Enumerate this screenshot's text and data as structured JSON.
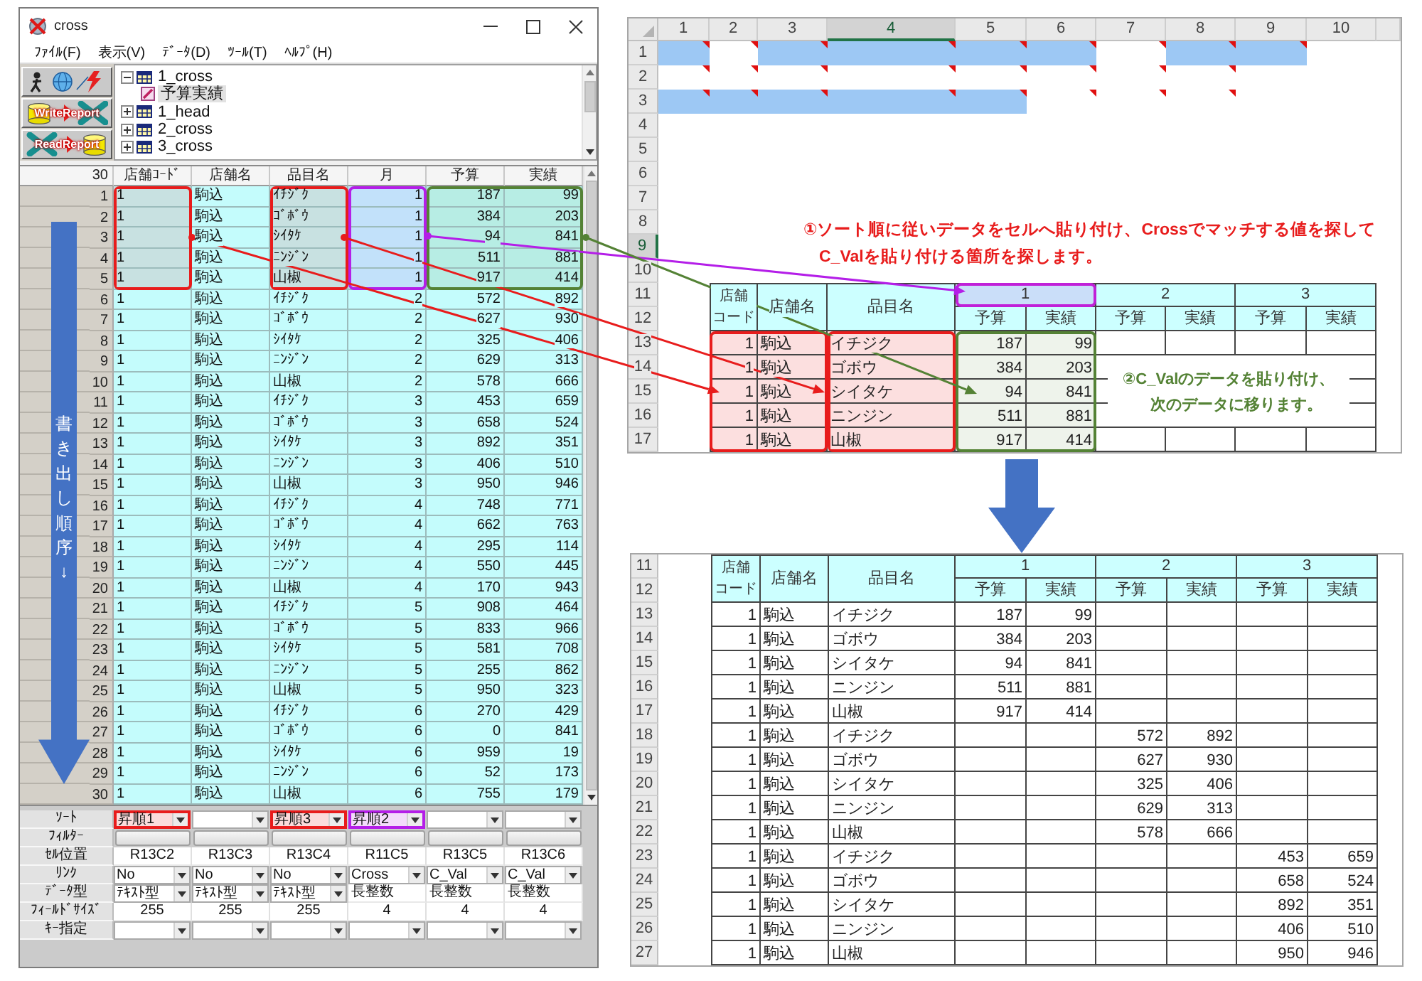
{
  "app_window": {
    "title": "cross",
    "menu": [
      "ﾌｧｲﾙ(F)",
      "表示(V)",
      "ﾃﾞｰﾀ(D)",
      "ﾂｰﾙ(T)",
      "ﾍﾙﾌﾟ(H)"
    ],
    "toolbar": [
      {
        "kind": "connect"
      },
      {
        "kind": "write",
        "label": "WriteReport"
      },
      {
        "kind": "read",
        "label": "ReadReport"
      }
    ],
    "tree": [
      {
        "label": "1_cross",
        "expanded": true,
        "selected": false,
        "children": [
          {
            "label": "予算実績",
            "selected": true
          }
        ]
      },
      {
        "label": "1_head",
        "expanded": false,
        "selected": false
      },
      {
        "label": "2_cross",
        "expanded": false,
        "selected": false
      },
      {
        "label": "3_cross",
        "expanded": false,
        "selected": false
      }
    ],
    "grid": {
      "corner": "30",
      "order_label": "書き出し順序↓",
      "columns": [
        {
          "label": "店舗ｺｰﾄﾞ",
          "kind": "text",
          "color": "#e81c1c"
        },
        {
          "label": "店舗名",
          "kind": "text"
        },
        {
          "label": "品目名",
          "kind": "text",
          "color": "#e81c1c"
        },
        {
          "label": "月",
          "kind": "number",
          "color": "#b41ee8"
        },
        {
          "label": "予算",
          "kind": "number",
          "color": "#548235"
        },
        {
          "label": "実績",
          "kind": "number",
          "color": "#548235"
        }
      ],
      "rows": [
        {
          "number": "1",
          "highlighted": true,
          "cells": [
            "1",
            "駒込",
            "ｲﾁｼﾞｸ",
            "1",
            "187",
            "99"
          ]
        },
        {
          "number": "2",
          "highlighted": true,
          "cells": [
            "1",
            "駒込",
            "ｺﾞﾎﾞｳ",
            "1",
            "384",
            "203"
          ]
        },
        {
          "number": "3",
          "highlighted": true,
          "cells": [
            "1",
            "駒込",
            "ｼｲﾀｹ",
            "1",
            "94",
            "841"
          ]
        },
        {
          "number": "4",
          "highlighted": true,
          "cells": [
            "1",
            "駒込",
            "ﾆﾝｼﾞﾝ",
            "1",
            "511",
            "881"
          ]
        },
        {
          "number": "5",
          "highlighted": true,
          "cells": [
            "1",
            "駒込",
            "山椒",
            "1",
            "917",
            "414"
          ]
        },
        {
          "number": "6",
          "highlighted": false,
          "cells": [
            "1",
            "駒込",
            "ｲﾁｼﾞｸ",
            "2",
            "572",
            "892"
          ]
        },
        {
          "number": "7",
          "highlighted": false,
          "cells": [
            "1",
            "駒込",
            "ｺﾞﾎﾞｳ",
            "2",
            "627",
            "930"
          ]
        },
        {
          "number": "8",
          "highlighted": false,
          "cells": [
            "1",
            "駒込",
            "ｼｲﾀｹ",
            "2",
            "325",
            "406"
          ]
        },
        {
          "number": "9",
          "highlighted": false,
          "cells": [
            "1",
            "駒込",
            "ﾆﾝｼﾞﾝ",
            "2",
            "629",
            "313"
          ]
        },
        {
          "number": "10",
          "highlighted": false,
          "cells": [
            "1",
            "駒込",
            "山椒",
            "2",
            "578",
            "666"
          ]
        },
        {
          "number": "11",
          "highlighted": false,
          "cells": [
            "1",
            "駒込",
            "ｲﾁｼﾞｸ",
            "3",
            "453",
            "659"
          ]
        },
        {
          "number": "12",
          "highlighted": false,
          "cells": [
            "1",
            "駒込",
            "ｺﾞﾎﾞｳ",
            "3",
            "658",
            "524"
          ]
        },
        {
          "number": "13",
          "highlighted": false,
          "cells": [
            "1",
            "駒込",
            "ｼｲﾀｹ",
            "3",
            "892",
            "351"
          ]
        },
        {
          "number": "14",
          "highlighted": false,
          "cells": [
            "1",
            "駒込",
            "ﾆﾝｼﾞﾝ",
            "3",
            "406",
            "510"
          ]
        },
        {
          "number": "15",
          "highlighted": false,
          "cells": [
            "1",
            "駒込",
            "山椒",
            "3",
            "950",
            "946"
          ]
        },
        {
          "number": "16",
          "highlighted": false,
          "cells": [
            "1",
            "駒込",
            "ｲﾁｼﾞｸ",
            "4",
            "748",
            "771"
          ]
        },
        {
          "number": "17",
          "highlighted": false,
          "cells": [
            "1",
            "駒込",
            "ｺﾞﾎﾞｳ",
            "4",
            "662",
            "763"
          ]
        },
        {
          "number": "18",
          "highlighted": false,
          "cells": [
            "1",
            "駒込",
            "ｼｲﾀｹ",
            "4",
            "295",
            "114"
          ]
        },
        {
          "number": "19",
          "highlighted": false,
          "cells": [
            "1",
            "駒込",
            "ﾆﾝｼﾞﾝ",
            "4",
            "550",
            "445"
          ]
        },
        {
          "number": "20",
          "highlighted": false,
          "cells": [
            "1",
            "駒込",
            "山椒",
            "4",
            "170",
            "943"
          ]
        },
        {
          "number": "21",
          "highlighted": false,
          "cells": [
            "1",
            "駒込",
            "ｲﾁｼﾞｸ",
            "5",
            "908",
            "464"
          ]
        },
        {
          "number": "22",
          "highlighted": false,
          "cells": [
            "1",
            "駒込",
            "ｺﾞﾎﾞｳ",
            "5",
            "833",
            "966"
          ]
        },
        {
          "number": "23",
          "highlighted": false,
          "cells": [
            "1",
            "駒込",
            "ｼｲﾀｹ",
            "5",
            "581",
            "708"
          ]
        },
        {
          "number": "24",
          "highlighted": false,
          "cells": [
            "1",
            "駒込",
            "ﾆﾝｼﾞﾝ",
            "5",
            "255",
            "862"
          ]
        },
        {
          "number": "25",
          "highlighted": false,
          "cells": [
            "1",
            "駒込",
            "山椒",
            "5",
            "950",
            "323"
          ]
        },
        {
          "number": "26",
          "highlighted": false,
          "cells": [
            "1",
            "駒込",
            "ｲﾁｼﾞｸ",
            "6",
            "270",
            "429"
          ]
        },
        {
          "number": "27",
          "highlighted": false,
          "cells": [
            "1",
            "駒込",
            "ｺﾞﾎﾞｳ",
            "6",
            "0",
            "841"
          ]
        },
        {
          "number": "28",
          "highlighted": false,
          "cells": [
            "1",
            "駒込",
            "ｼｲﾀｹ",
            "6",
            "959",
            "19"
          ]
        },
        {
          "number": "29",
          "highlighted": false,
          "cells": [
            "1",
            "駒込",
            "ﾆﾝｼﾞﾝ",
            "6",
            "52",
            "173"
          ]
        },
        {
          "number": "30",
          "highlighted": false,
          "cells": [
            "1",
            "駒込",
            "山椒",
            "6",
            "755",
            "179"
          ]
        }
      ]
    },
    "settings": [
      {
        "label": "ｿｰﾄ",
        "cells": [
          {
            "kind": "dropdown",
            "value": "昇順1",
            "color": "#e81c1c"
          },
          {
            "kind": "dropdown"
          },
          {
            "kind": "dropdown",
            "value": "昇順3",
            "color": "#e81c1c"
          },
          {
            "kind": "dropdown",
            "value": "昇順2",
            "color": "#b41ee8"
          },
          {
            "kind": "dropdown"
          },
          {
            "kind": "dropdown"
          }
        ]
      },
      {
        "label": "ﾌｨﾙﾀｰ",
        "cells": [
          {
            "kind": "button"
          },
          {
            "kind": "button"
          },
          {
            "kind": "button"
          },
          {
            "kind": "button"
          },
          {
            "kind": "button"
          },
          {
            "kind": "button"
          }
        ]
      },
      {
        "label": "ｾﾙ位置",
        "cells": [
          {
            "kind": "readout",
            "value": "R13C2"
          },
          {
            "kind": "readout",
            "value": "R13C3"
          },
          {
            "kind": "readout",
            "value": "R13C4"
          },
          {
            "kind": "readout",
            "value": "R11C5"
          },
          {
            "kind": "readout",
            "value": "R13C5"
          },
          {
            "kind": "readout",
            "value": "R13C6"
          }
        ]
      },
      {
        "label": "ﾘﾝｸ",
        "cells": [
          {
            "kind": "dropdown",
            "value": "No"
          },
          {
            "kind": "dropdown",
            "value": "No"
          },
          {
            "kind": "dropdown",
            "value": "No"
          },
          {
            "kind": "dropdown",
            "value": "Cross"
          },
          {
            "kind": "dropdown",
            "value": "C_Val"
          },
          {
            "kind": "dropdown",
            "value": "C_Val"
          }
        ]
      },
      {
        "label": "ﾃﾞｰﾀ型",
        "cells": [
          {
            "kind": "dropdown",
            "value": "ﾃｷｽﾄ型"
          },
          {
            "kind": "dropdown",
            "value": "ﾃｷｽﾄ型"
          },
          {
            "kind": "dropdown",
            "value": "ﾃｷｽﾄ型"
          },
          {
            "kind": "text",
            "value": "長整数"
          },
          {
            "kind": "text",
            "value": "長整数"
          },
          {
            "kind": "text",
            "value": "長整数"
          }
        ]
      },
      {
        "label": "ﾌｨｰﾙﾄﾞｻｲｽﾞ",
        "cells": [
          {
            "kind": "readout",
            "value": "255"
          },
          {
            "kind": "readout",
            "value": "255"
          },
          {
            "kind": "readout",
            "value": "255"
          },
          {
            "kind": "readout",
            "value": "4"
          },
          {
            "kind": "readout",
            "value": "4"
          },
          {
            "kind": "readout",
            "value": "4"
          }
        ]
      },
      {
        "label": "ｷｰ指定",
        "cells": [
          {
            "kind": "dropdown"
          },
          {
            "kind": "dropdown"
          },
          {
            "kind": "dropdown"
          },
          {
            "kind": "dropdown"
          },
          {
            "kind": "dropdown"
          },
          {
            "kind": "dropdown"
          }
        ]
      }
    ]
  },
  "sheet_top": {
    "columns": [
      {
        "label": "1",
        "selected": false
      },
      {
        "label": "2",
        "selected": false
      },
      {
        "label": "3",
        "selected": false
      },
      {
        "label": "4",
        "selected": true
      },
      {
        "label": "5",
        "selected": false
      },
      {
        "label": "6",
        "selected": false
      },
      {
        "label": "7",
        "selected": false
      },
      {
        "label": "8",
        "selected": false
      },
      {
        "label": "9",
        "selected": false
      },
      {
        "label": "10",
        "selected": false
      }
    ],
    "rows": [
      {
        "label": "1",
        "selected": false
      },
      {
        "label": "2",
        "selected": false
      },
      {
        "label": "3",
        "selected": false
      },
      {
        "label": "4",
        "selected": false
      },
      {
        "label": "5",
        "selected": false
      },
      {
        "label": "6",
        "selected": false
      },
      {
        "label": "7",
        "selected": false
      },
      {
        "label": "8",
        "selected": false
      },
      {
        "label": "9",
        "selected": true
      },
      {
        "label": "10",
        "selected": false
      },
      {
        "label": "11",
        "selected": false
      },
      {
        "label": "12",
        "selected": false
      },
      {
        "label": "13",
        "selected": false
      },
      {
        "label": "14",
        "selected": false
      },
      {
        "label": "15",
        "selected": false
      },
      {
        "label": "16",
        "selected": false
      },
      {
        "label": "17",
        "selected": false
      }
    ],
    "marked_rows": [
      {
        "cells": [
          {
            "filled": true,
            "comment": true
          },
          {
            "filled": false,
            "comment": true
          },
          {
            "filled": true,
            "comment": true
          },
          {
            "filled": true,
            "comment": true
          },
          {
            "filled": true,
            "comment": true
          },
          {
            "filled": true,
            "comment": true
          },
          {
            "filled": false,
            "comment": true
          },
          {
            "filled": true,
            "comment": true
          },
          {
            "filled": true,
            "comment": true
          },
          {
            "filled": false,
            "comment": false
          }
        ]
      },
      {
        "cells": [
          {
            "filled": false,
            "comment": true
          },
          {
            "filled": false,
            "comment": true
          },
          {
            "filled": false,
            "comment": true
          },
          {
            "filled": false,
            "comment": true
          },
          {
            "filled": false,
            "comment": true
          },
          {
            "filled": false,
            "comment": true
          },
          {
            "filled": false,
            "comment": true
          },
          {
            "filled": false,
            "comment": true
          },
          {
            "filled": false,
            "comment": false
          },
          {
            "filled": false,
            "comment": false
          }
        ]
      },
      {
        "cells": [
          {
            "filled": true,
            "comment": true
          },
          {
            "filled": true,
            "comment": true
          },
          {
            "filled": true,
            "comment": true
          },
          {
            "filled": true,
            "comment": true
          },
          {
            "filled": true,
            "comment": true
          },
          {
            "filled": false,
            "comment": true
          },
          {
            "filled": false,
            "comment": true
          },
          {
            "filled": false,
            "comment": true
          },
          {
            "filled": false,
            "comment": false
          },
          {
            "filled": false,
            "comment": false
          }
        ]
      }
    ],
    "notes": [
      {
        "color": "#e81c1c",
        "lines": [
          "①ソート順に従いデータをセルへ貼り付け、Crossでマッチする値を探して",
          "C_Valを貼り付ける箇所を探します。"
        ]
      },
      {
        "color": "#548235",
        "lines": [
          "②C_Valのデータを貼り付け、",
          "次のデータに移ります。"
        ]
      }
    ],
    "table": {
      "key_groups": [
        {
          "color": "#e81c1c",
          "headers": [
            "店舗コード",
            "店舗名"
          ]
        },
        {
          "color": "#e81c1c",
          "headers": [
            "品目名"
          ]
        }
      ],
      "months": [
        {
          "label": "1",
          "color": "#c020d8",
          "subcolumns": {
            "color": "#548235",
            "labels": [
              "予算",
              "実績"
            ]
          }
        },
        {
          "label": "2",
          "subcolumns": {
            "labels": [
              "予算",
              "実績"
            ]
          }
        },
        {
          "label": "3",
          "subcolumns": {
            "labels": [
              "予算",
              "実績"
            ]
          }
        }
      ],
      "rows": [
        [
          "1",
          "駒込",
          "イチジク",
          "187",
          "99"
        ],
        [
          "1",
          "駒込",
          "ゴボウ",
          "384",
          "203"
        ],
        [
          "1",
          "駒込",
          "シイタケ",
          "94",
          "841"
        ],
        [
          "1",
          "駒込",
          "ニンジン",
          "511",
          "881"
        ],
        [
          "1",
          "駒込",
          "山椒",
          "917",
          "414"
        ]
      ]
    }
  },
  "sheet_bottom": {
    "row_headers": [
      "11",
      "12",
      "13",
      "14",
      "15",
      "16",
      "17",
      "18",
      "19",
      "20",
      "21",
      "22",
      "23",
      "24",
      "25",
      "26",
      "27"
    ],
    "table": {
      "key_groups": [
        {
          "headers": [
            "店舗コード",
            "店舗名",
            "品目名"
          ]
        }
      ],
      "months": [
        {
          "label": "1",
          "subcolumns": {
            "labels": [
              "予算",
              "実績"
            ]
          }
        },
        {
          "label": "2",
          "subcolumns": {
            "labels": [
              "予算",
              "実績"
            ]
          }
        },
        {
          "label": "3",
          "subcolumns": {
            "labels": [
              "予算",
              "実績"
            ]
          }
        }
      ],
      "rows": [
        [
          "1",
          "駒込",
          "イチジク",
          "187",
          "99"
        ],
        [
          "1",
          "駒込",
          "ゴボウ",
          "384",
          "203"
        ],
        [
          "1",
          "駒込",
          "シイタケ",
          "94",
          "841"
        ],
        [
          "1",
          "駒込",
          "ニンジン",
          "511",
          "881"
        ],
        [
          "1",
          "駒込",
          "山椒",
          "917",
          "414"
        ],
        [
          "1",
          "駒込",
          "イチジク",
          null,
          null,
          "572",
          "892"
        ],
        [
          "1",
          "駒込",
          "ゴボウ",
          null,
          null,
          "627",
          "930"
        ],
        [
          "1",
          "駒込",
          "シイタケ",
          null,
          null,
          "325",
          "406"
        ],
        [
          "1",
          "駒込",
          "ニンジン",
          null,
          null,
          "629",
          "313"
        ],
        [
          "1",
          "駒込",
          "山椒",
          null,
          null,
          "578",
          "666"
        ],
        [
          "1",
          "駒込",
          "イチジク",
          null,
          null,
          null,
          null,
          "453",
          "659"
        ],
        [
          "1",
          "駒込",
          "ゴボウ",
          null,
          null,
          null,
          null,
          "658",
          "524"
        ],
        [
          "1",
          "駒込",
          "シイタケ",
          null,
          null,
          null,
          null,
          "892",
          "351"
        ],
        [
          "1",
          "駒込",
          "ニンジン",
          null,
          null,
          null,
          null,
          "406",
          "510"
        ],
        [
          "1",
          "駒込",
          "山椒",
          null,
          null,
          null,
          null,
          "950",
          "946"
        ]
      ]
    }
  }
}
